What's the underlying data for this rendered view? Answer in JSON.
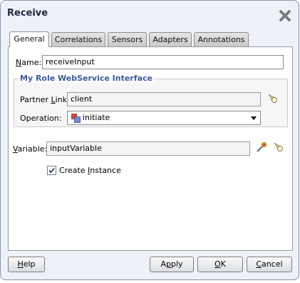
{
  "window": {
    "title": "Receive"
  },
  "tabs": [
    {
      "label": "General",
      "active": true
    },
    {
      "label": "Correlations",
      "active": false
    },
    {
      "label": "Sensors",
      "active": false
    },
    {
      "label": "Adapters",
      "active": false
    },
    {
      "label": "Annotations",
      "active": false
    }
  ],
  "general": {
    "name_mnemonic": "N",
    "name_rest": "ame:",
    "name_value": "receiveInput",
    "group_title": "My Role WebService Interface",
    "partner_link_prefix": "Partner ",
    "partner_link_mnemonic": "L",
    "partner_link_rest": "ink:",
    "partner_link_value": "client",
    "operation_label": "Operation:",
    "operation_value": "initiate",
    "variable_mnemonic": "V",
    "variable_rest": "ariable:",
    "variable_value": "inputVariable",
    "create_instance_prefix": "Create ",
    "create_instance_mnemonic": "I",
    "create_instance_rest": "nstance",
    "create_instance_checked": true
  },
  "buttons": {
    "help_mnemonic": "H",
    "help_rest": "elp",
    "apply_prefix": "A",
    "apply_mnemonic": "p",
    "apply_rest": "ply",
    "ok_mnemonic": "O",
    "ok_rest": "K",
    "cancel_mnemonic": "C",
    "cancel_rest": "ancel"
  },
  "icons": {
    "close": "close-x-icon",
    "partner_link_browse": "flashlight-icon",
    "operation": "operation-icon",
    "variable_create": "create-variable-icon",
    "variable_browse": "flashlight-icon"
  },
  "colors": {
    "group_title": "#3a5a9c",
    "dialog_bg": "#eef1f8"
  }
}
